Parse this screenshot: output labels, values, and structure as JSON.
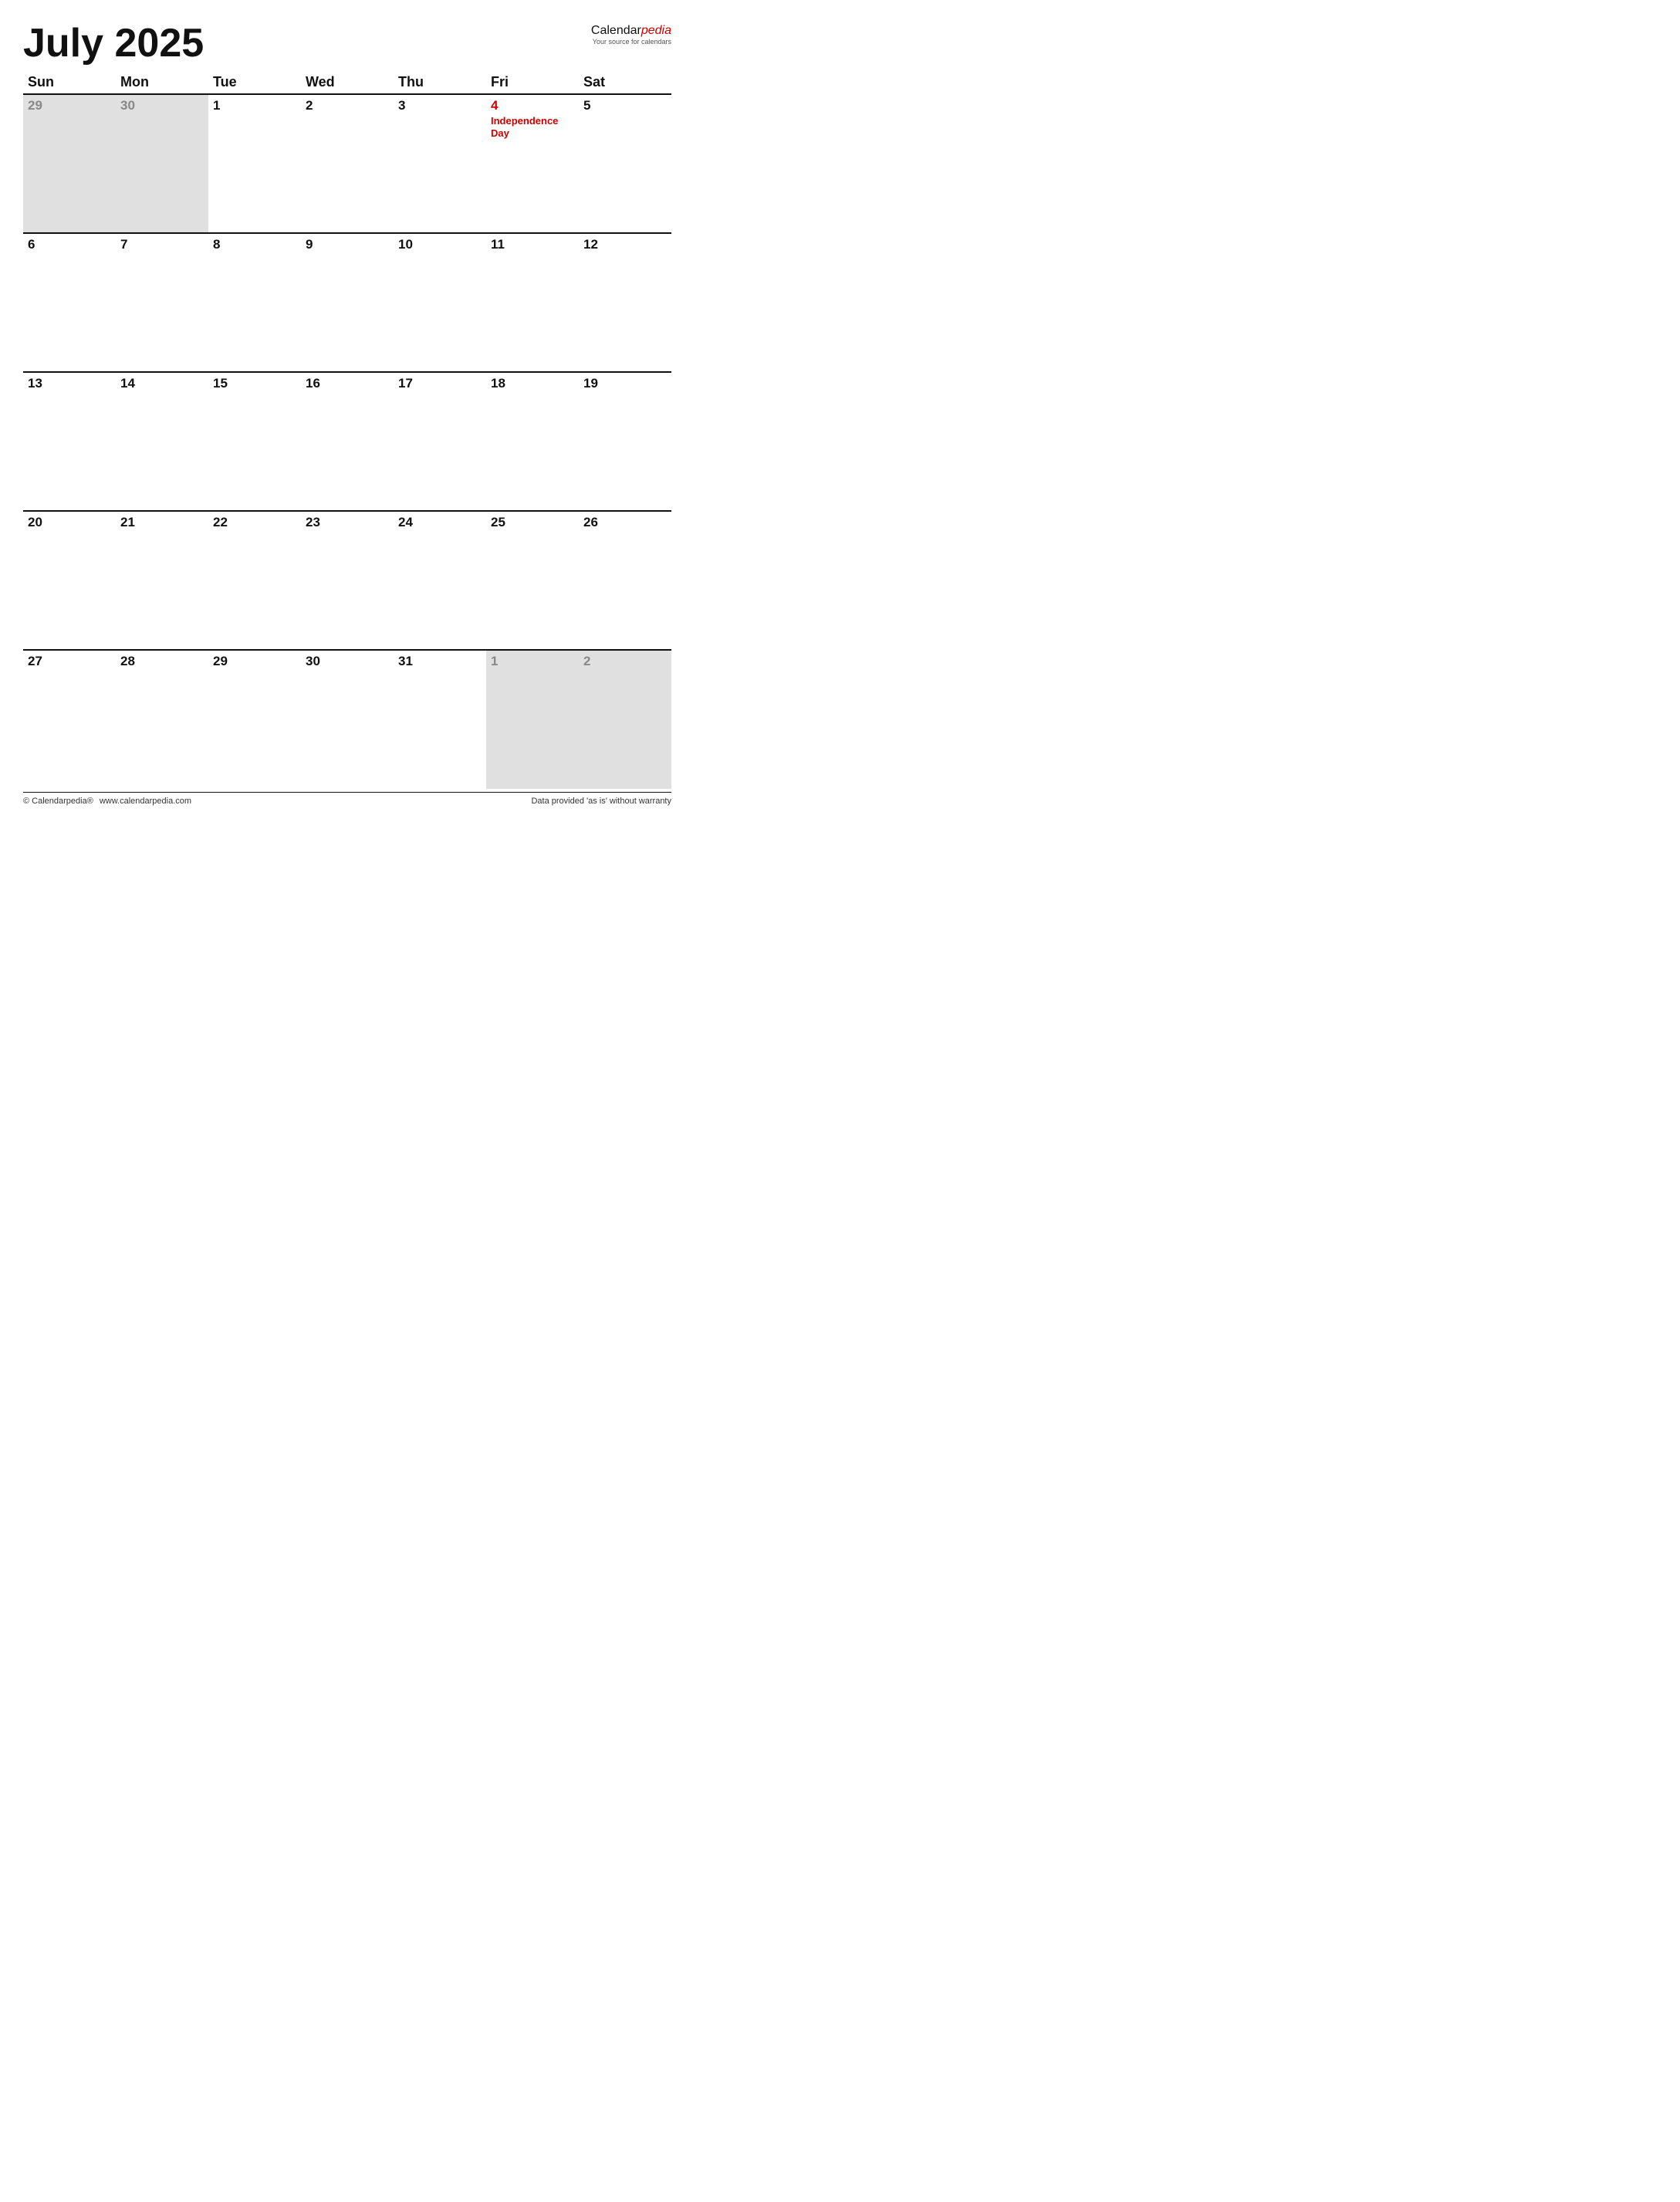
{
  "header": {
    "title": "July 2025",
    "brand_name_plain": "Calendar",
    "brand_name_italic": "pedia",
    "brand_sub": "Your source for calendars"
  },
  "days_of_week": [
    "Sun",
    "Mon",
    "Tue",
    "Wed",
    "Thu",
    "Fri",
    "Sat"
  ],
  "weeks": [
    [
      {
        "date": "29",
        "outside": true,
        "holiday": false,
        "holiday_label": ""
      },
      {
        "date": "30",
        "outside": true,
        "holiday": false,
        "holiday_label": ""
      },
      {
        "date": "1",
        "outside": false,
        "holiday": false,
        "holiday_label": ""
      },
      {
        "date": "2",
        "outside": false,
        "holiday": false,
        "holiday_label": ""
      },
      {
        "date": "3",
        "outside": false,
        "holiday": false,
        "holiday_label": ""
      },
      {
        "date": "4",
        "outside": false,
        "holiday": true,
        "holiday_label": "Independence Day"
      },
      {
        "date": "5",
        "outside": false,
        "holiday": false,
        "holiday_label": ""
      }
    ],
    [
      {
        "date": "6",
        "outside": false,
        "holiday": false,
        "holiday_label": ""
      },
      {
        "date": "7",
        "outside": false,
        "holiday": false,
        "holiday_label": ""
      },
      {
        "date": "8",
        "outside": false,
        "holiday": false,
        "holiday_label": ""
      },
      {
        "date": "9",
        "outside": false,
        "holiday": false,
        "holiday_label": ""
      },
      {
        "date": "10",
        "outside": false,
        "holiday": false,
        "holiday_label": ""
      },
      {
        "date": "11",
        "outside": false,
        "holiday": false,
        "holiday_label": ""
      },
      {
        "date": "12",
        "outside": false,
        "holiday": false,
        "holiday_label": ""
      }
    ],
    [
      {
        "date": "13",
        "outside": false,
        "holiday": false,
        "holiday_label": ""
      },
      {
        "date": "14",
        "outside": false,
        "holiday": false,
        "holiday_label": ""
      },
      {
        "date": "15",
        "outside": false,
        "holiday": false,
        "holiday_label": ""
      },
      {
        "date": "16",
        "outside": false,
        "holiday": false,
        "holiday_label": ""
      },
      {
        "date": "17",
        "outside": false,
        "holiday": false,
        "holiday_label": ""
      },
      {
        "date": "18",
        "outside": false,
        "holiday": false,
        "holiday_label": ""
      },
      {
        "date": "19",
        "outside": false,
        "holiday": false,
        "holiday_label": ""
      }
    ],
    [
      {
        "date": "20",
        "outside": false,
        "holiday": false,
        "holiday_label": ""
      },
      {
        "date": "21",
        "outside": false,
        "holiday": false,
        "holiday_label": ""
      },
      {
        "date": "22",
        "outside": false,
        "holiday": false,
        "holiday_label": ""
      },
      {
        "date": "23",
        "outside": false,
        "holiday": false,
        "holiday_label": ""
      },
      {
        "date": "24",
        "outside": false,
        "holiday": false,
        "holiday_label": ""
      },
      {
        "date": "25",
        "outside": false,
        "holiday": false,
        "holiday_label": ""
      },
      {
        "date": "26",
        "outside": false,
        "holiday": false,
        "holiday_label": ""
      }
    ],
    [
      {
        "date": "27",
        "outside": false,
        "holiday": false,
        "holiday_label": ""
      },
      {
        "date": "28",
        "outside": false,
        "holiday": false,
        "holiday_label": ""
      },
      {
        "date": "29",
        "outside": false,
        "holiday": false,
        "holiday_label": ""
      },
      {
        "date": "30",
        "outside": false,
        "holiday": false,
        "holiday_label": ""
      },
      {
        "date": "31",
        "outside": false,
        "holiday": false,
        "holiday_label": ""
      },
      {
        "date": "1",
        "outside": true,
        "holiday": false,
        "holiday_label": ""
      },
      {
        "date": "2",
        "outside": true,
        "holiday": false,
        "holiday_label": ""
      }
    ]
  ],
  "footer": {
    "copyright": "© Calendarpedia®",
    "url": "www.calendarpedia.com",
    "disclaimer": "Data provided 'as is' without warranty"
  }
}
